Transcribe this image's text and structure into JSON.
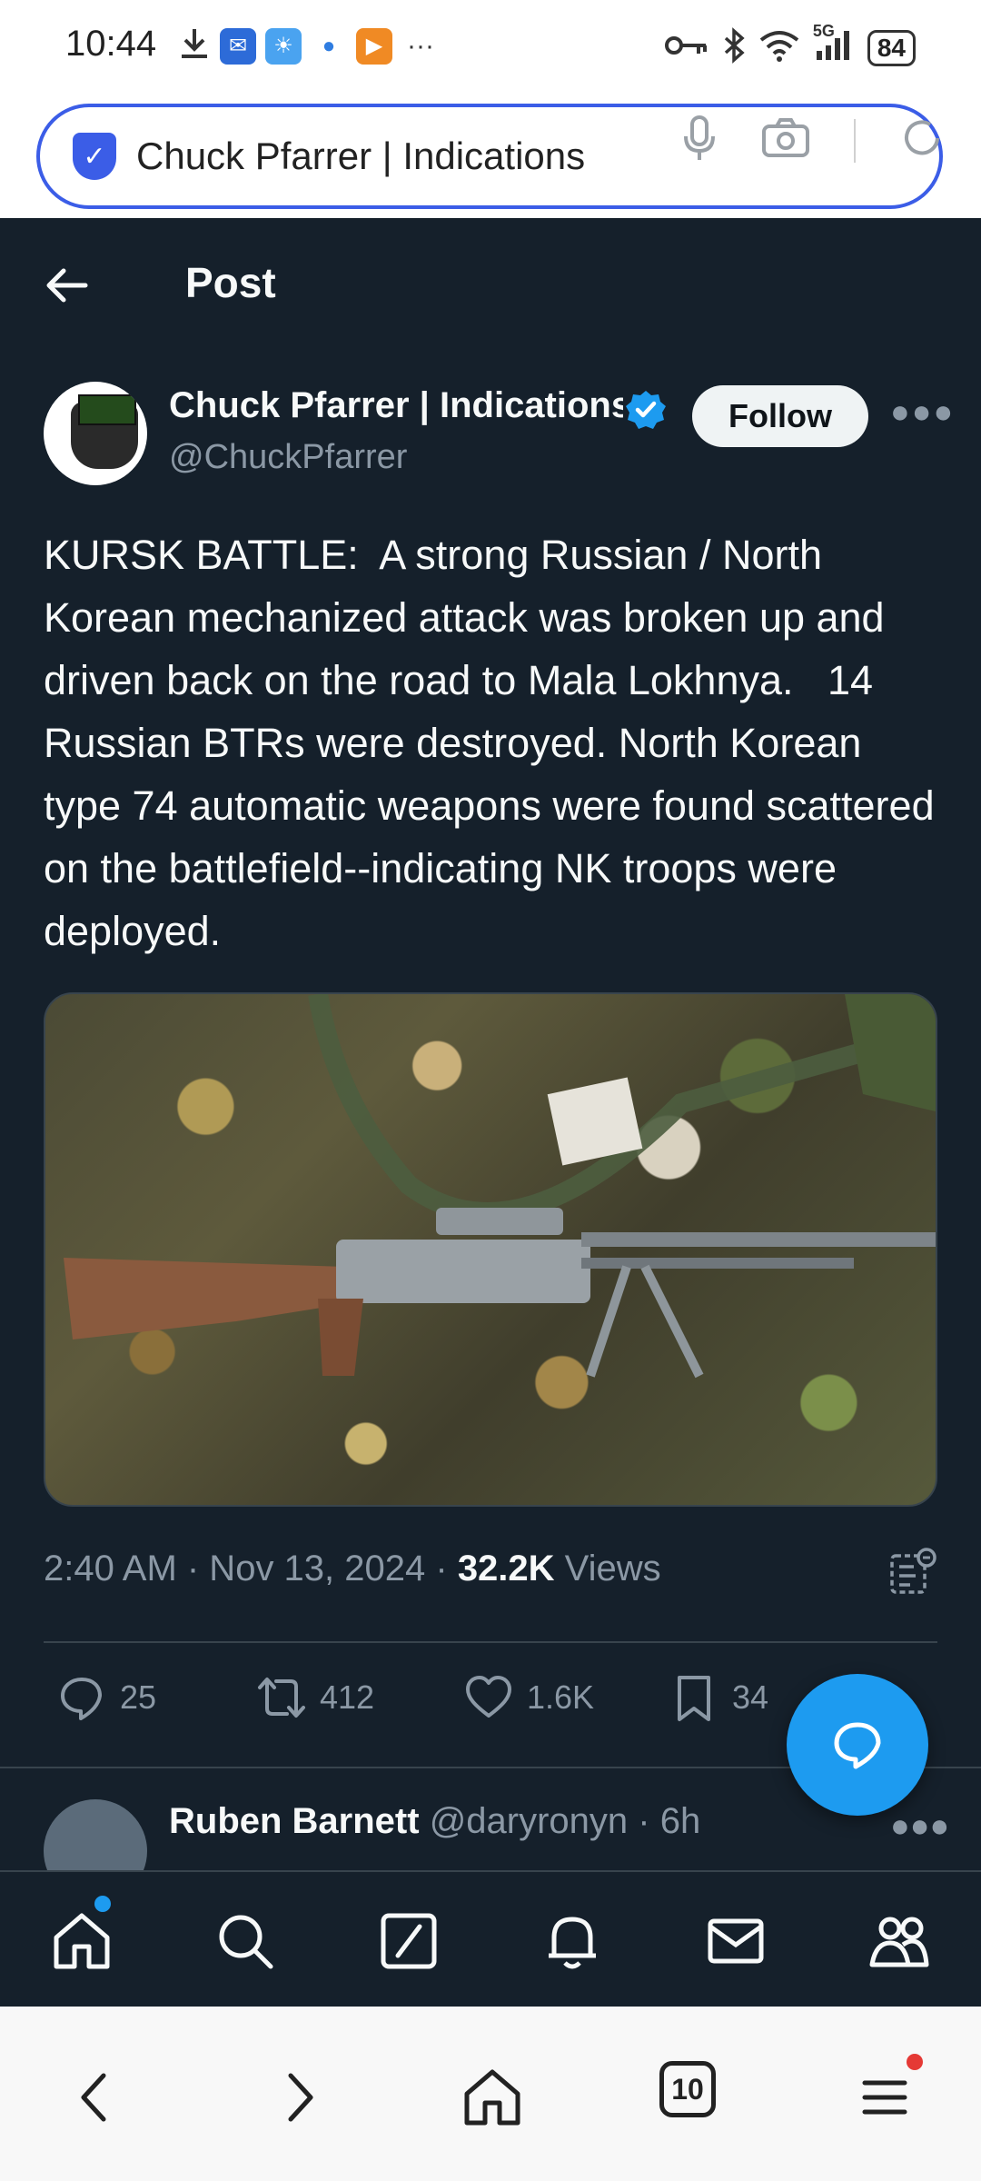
{
  "status_bar": {
    "time": "10:44",
    "network": "5G",
    "battery": "84",
    "icons": [
      "download-icon",
      "app-icon",
      "weather-icon",
      "browser-icon",
      "video-icon",
      "more-dots-icon",
      "key-icon",
      "bluetooth-icon",
      "wifi-icon",
      "signal-icon"
    ]
  },
  "browser": {
    "url_text": "Chuck Pfarrer | Indications",
    "tabs_count": "10"
  },
  "header": {
    "title": "Post"
  },
  "post": {
    "author_name": "Chuck Pfarrer | Indications",
    "author_handle": "@ChuckPfarrer",
    "follow_label": "Follow",
    "text": "KURSK BATTLE:  A strong Russian / North Korean mechanized attack was broken up and driven back on the road to Mala Lokhnya.   14 Russian BTRs were destroyed. North Korean type 74 automatic weapons were found scattered on the battlefield--indicating NK troops were deployed.",
    "timestamp": "2:40 AM · Nov 13, 2024 · ",
    "views_count": "32.2K",
    "views_label": " Views",
    "replies": "25",
    "reposts": "412",
    "likes": "1.6K",
    "bookmarks": "34"
  },
  "reply_preview": {
    "name": "Ruben Barnett",
    "handle_time": " @daryronyn · 6h"
  },
  "colors": {
    "background": "#15202b",
    "accent": "#1d9bf0",
    "muted": "#8b98a5",
    "browser_accent": "#3b5de7"
  }
}
